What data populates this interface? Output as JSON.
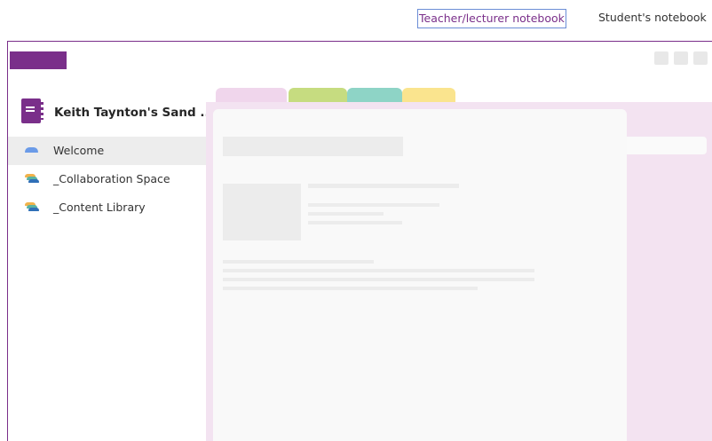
{
  "header": {
    "teacher_label": "Teacher/lecturer notebook",
    "student_label": "Student's notebook"
  },
  "notebook": {
    "title": "Keith Taynton's Sand ...",
    "icon": "notebook-icon",
    "accent_color": "#7a2f8a"
  },
  "sections": [
    {
      "label": "Welcome",
      "icon": "section-icon",
      "active": true
    },
    {
      "label": "_Collaboration Space",
      "icon": "section-group-icon",
      "active": false
    },
    {
      "label": "_Content Library",
      "icon": "section-group-icon",
      "active": false
    }
  ],
  "tab_colors": [
    "#f0d6ec",
    "#c6dc80",
    "#8ed4c6",
    "#fae48e"
  ]
}
